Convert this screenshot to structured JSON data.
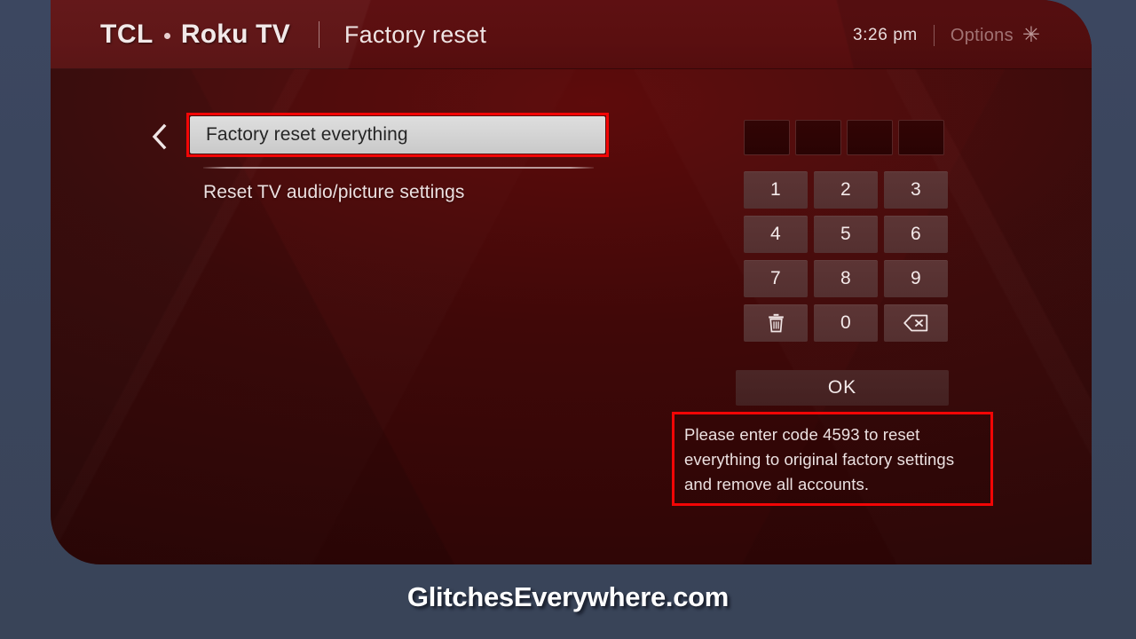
{
  "header": {
    "brand_tcl": "TCL",
    "brand_roku": "Roku TV",
    "title": "Factory reset",
    "clock": "3:26  pm",
    "options_label": "Options",
    "options_icon": "asterisk-icon",
    "star_glyph": "✳"
  },
  "menu": {
    "back_icon": "chevron-left-icon",
    "back_glyph": "‹",
    "items": [
      {
        "label": "Factory reset everything",
        "selected": true
      },
      {
        "label": "Reset TV audio/picture settings",
        "selected": false
      }
    ]
  },
  "keypad": {
    "code_boxes": [
      "",
      "",
      "",
      ""
    ],
    "keys": [
      {
        "label": "1",
        "icon": ""
      },
      {
        "label": "2",
        "icon": ""
      },
      {
        "label": "3",
        "icon": ""
      },
      {
        "label": "4",
        "icon": ""
      },
      {
        "label": "5",
        "icon": ""
      },
      {
        "label": "6",
        "icon": ""
      },
      {
        "label": "7",
        "icon": ""
      },
      {
        "label": "8",
        "icon": ""
      },
      {
        "label": "9",
        "icon": ""
      },
      {
        "label": "",
        "icon": "trash-icon"
      },
      {
        "label": "0",
        "icon": ""
      },
      {
        "label": "",
        "icon": "backspace-icon"
      }
    ],
    "ok_label": "OK"
  },
  "message": {
    "text": "Please enter code 4593 to reset everything to original factory settings and remove all accounts.",
    "code": "4593"
  },
  "watermark": {
    "text": "GlitchesEverywhere.com"
  },
  "colors": {
    "desktop_background": "#3a455c",
    "screen_background": "#3d0808",
    "header_background": "#5a0f10",
    "annotation_red": "#f20505",
    "selected_item_background": "#d4d4d4",
    "selected_item_text": "#262626",
    "key_background": "#5a3333",
    "text_primary": "#ece1e1"
  }
}
